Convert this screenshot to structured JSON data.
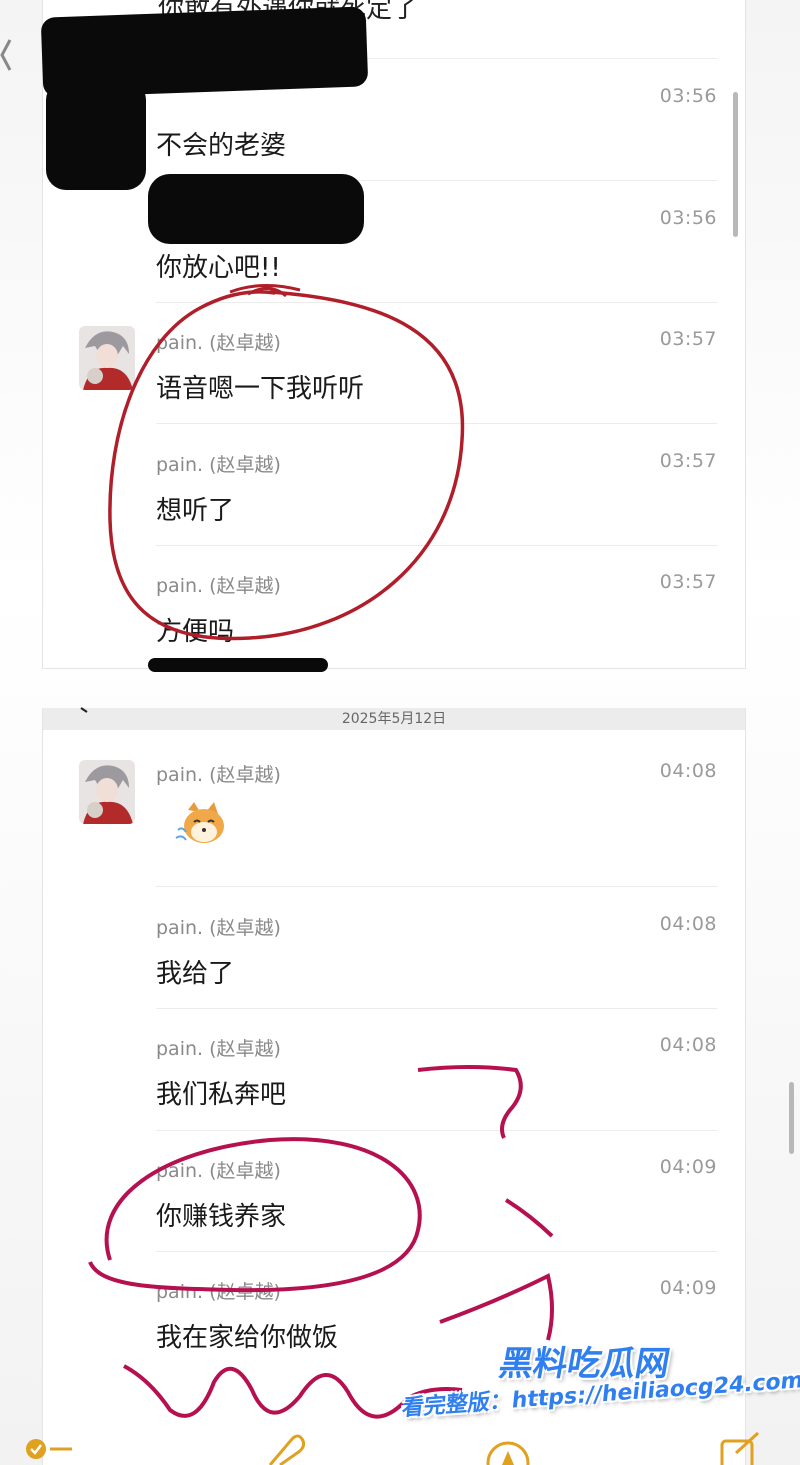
{
  "top_partial_text": "你敢有外遇你就死定了",
  "messages_top": [
    {
      "sender": "",
      "time": "03:56",
      "text": "不会的老婆"
    },
    {
      "sender": "",
      "time": "03:56",
      "text": "你放心吧!!"
    },
    {
      "sender": "pain. (赵卓越)",
      "time": "03:57",
      "text": "语音嗯一下我听听"
    },
    {
      "sender": "pain. (赵卓越)",
      "time": "03:57",
      "text": "想听了"
    },
    {
      "sender": "pain. (赵卓越)",
      "time": "03:57",
      "text": "方便吗"
    }
  ],
  "date_separator": "2025年5月12日",
  "messages_bottom": [
    {
      "sender": "pain. (赵卓越)",
      "time": "04:08",
      "text": ""
    },
    {
      "sender": "pain. (赵卓越)",
      "time": "04:08",
      "text": "我给了"
    },
    {
      "sender": "pain. (赵卓越)",
      "time": "04:08",
      "text": "我们私奔吧"
    },
    {
      "sender": "pain. (赵卓越)",
      "time": "04:09",
      "text": "你赚钱养家"
    },
    {
      "sender": "pain. (赵卓越)",
      "time": "04:09",
      "text": "我在家给你做饭"
    }
  ],
  "watermark": {
    "title": "黑料吃瓜网",
    "subtitle": "看完整版：https://heiliaocg24.com"
  },
  "icons": {
    "back": "chevron-left-icon",
    "sticker": "shiba-dog-sticker-icon",
    "checklist": "checklist-icon",
    "attach": "paperclip-icon",
    "markup": "pen-circle-icon",
    "compose": "compose-icon"
  },
  "colors": {
    "annotation_red": "#b01e2a",
    "annotation_magenta": "#b5104f",
    "watermark_blue": "#2f7ff0"
  }
}
